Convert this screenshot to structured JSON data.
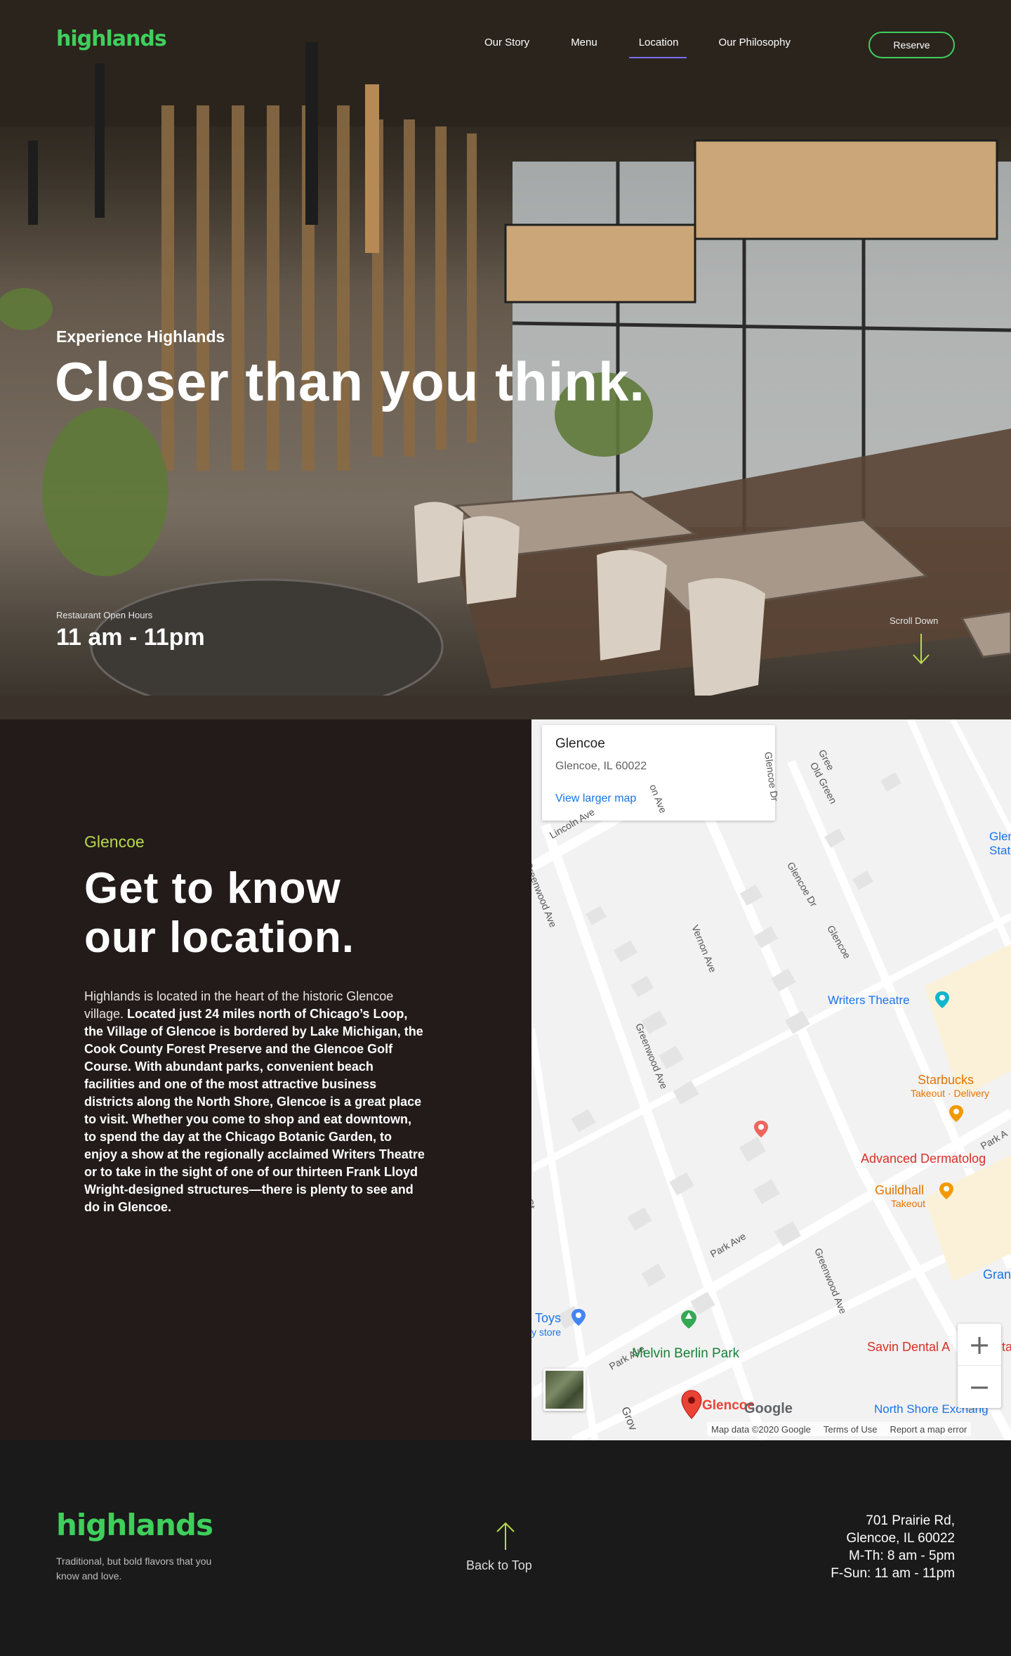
{
  "brand": {
    "name": "highlands",
    "color": "#3fcf5c"
  },
  "nav": {
    "items": [
      {
        "label": "Our Story",
        "active": false
      },
      {
        "label": "Menu",
        "active": false
      },
      {
        "label": "Location",
        "active": true
      },
      {
        "label": "Our Philosophy",
        "active": false
      }
    ],
    "reserve_label": "Reserve"
  },
  "hero": {
    "kicker": "Experience Highlands",
    "headline": "Closer than you think.",
    "hours_label": "Restaurant Open Hours",
    "hours_value": "11 am - 11pm",
    "scroll_label": "Scroll Down",
    "scroll_icon": "arrow-down-icon"
  },
  "location": {
    "eyebrow": "Glencoe",
    "title_line1": "Get to know",
    "title_line2": "our location.",
    "body_lead": "Highlands is located in the heart of the historic Glencoe village.",
    "body_rest": "Located just 24 miles north of Chicago’s Loop, the Village of Glencoe is bordered by Lake Michigan, the Cook County Forest Preserve and the Glencoe Golf Course. With abundant parks, convenient beach facilities and one of the most attractive business districts along the North Shore, Glencoe is a great place to visit. Whether you come to shop and eat downtown, to spend the day at the Chicago Botanic Garden, to enjoy a show at the regionally acclaimed Writers Theatre or to take in the sight of one of our thirteen Frank Lloyd Wright-designed structures—there is plenty to see and do in Glencoe."
  },
  "map": {
    "card_title": "Glencoe",
    "card_address": "Glencoe, IL 60022",
    "card_link": "View larger map",
    "marker_label": "Glencoe",
    "zoom_in": "+",
    "zoom_out": "−",
    "google_logo": "Google",
    "attribution": [
      "Map data ©2020 Google",
      "Terms of Use",
      "Report a map error"
    ],
    "streets": {
      "lincoln": "Lincoln Ave",
      "greenwood1": "Greenwood Ave",
      "greenwood2": "Greenwood Ave",
      "greenwood3": "Greenwood Ave",
      "vernon": "Vernon Ave",
      "vernon_top": "on Ave",
      "glencoe_dr1": "Glencoe Dr",
      "glencoe_dr2": "Glencoe Dr",
      "glencoe_dr3": "Glencoe",
      "green_bay": "Gree",
      "old_green": "Old Green",
      "park1": "Park Ave",
      "park2": "Park Ave",
      "park3": "Park A",
      "st": "St",
      "grov": "Grov"
    },
    "places": {
      "station1": "Glencoe",
      "station2": "Station",
      "writers": "Writers Theatre",
      "starbucks": "Starbucks",
      "starbucks_sub": "Takeout · Delivery",
      "derm": "Advanced Dermatolog",
      "guildhall": "Guildhall",
      "guildhall_sub": "Takeout",
      "gran": "Gran",
      "toys": "Toys",
      "toys_sub": "y store",
      "melvin": "Melvin Berlin Park",
      "savin": "Savin Dental A",
      "savin_tail": "ta",
      "north_shore": "North Shore Exchang"
    },
    "colors": {
      "accent_red": "#ea4335",
      "park_green": "#188038",
      "food_orange": "#e37400",
      "link_blue": "#1a73e8"
    }
  },
  "footer": {
    "tagline": "Traditional, but bold flavors that you know and love.",
    "back_to_top": "Back to Top",
    "back_icon": "arrow-up-icon",
    "address": [
      "701 Prairie Rd,",
      "Glencoe, IL 60022",
      "M-Th: 8 am - 5pm",
      "F-Sun: 11 am - 11pm"
    ]
  }
}
